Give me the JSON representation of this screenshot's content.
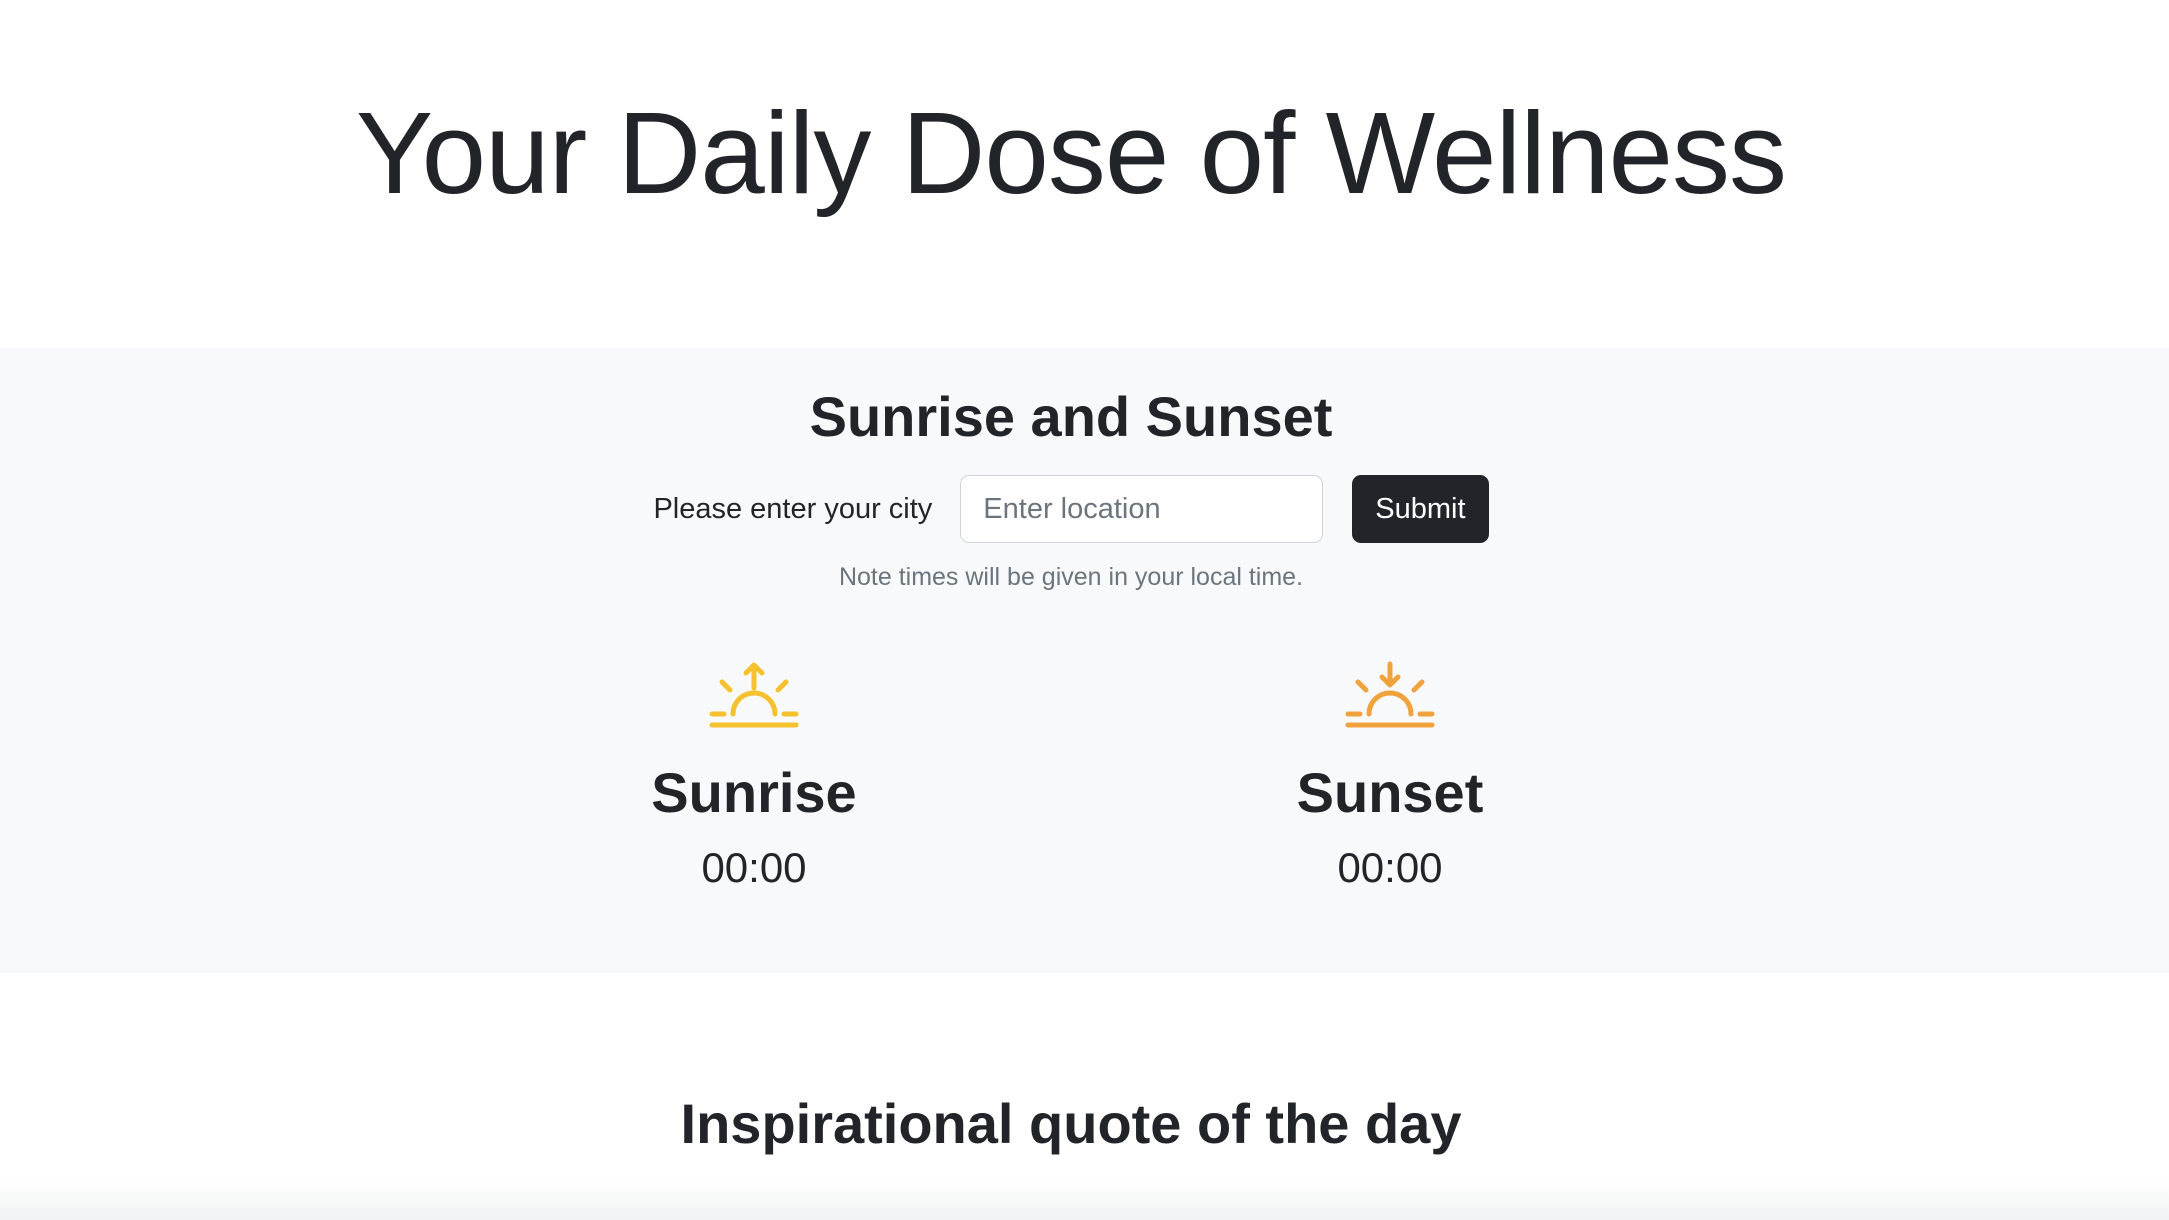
{
  "hero": {
    "title": "Your Daily Dose of Wellness"
  },
  "sun_section": {
    "title": "Sunrise and Sunset",
    "form": {
      "label": "Please enter your city",
      "input_value": "",
      "input_placeholder": "Enter location",
      "submit_label": "Submit"
    },
    "note": "Note times will be given in your local time.",
    "sunrise": {
      "icon": "sunrise-icon",
      "icon_color": "#f5c12e",
      "label": "Sunrise",
      "time": "00:00"
    },
    "sunset": {
      "icon": "sunset-icon",
      "icon_color": "#f0a33c",
      "label": "Sunset",
      "time": "00:00"
    }
  },
  "quote_section": {
    "title": "Inspirational quote of the day"
  },
  "colors": {
    "text": "#212529",
    "muted": "#6c757d",
    "section_bg": "#f8f9fa",
    "button_bg": "#212529",
    "button_text": "#ffffff"
  }
}
